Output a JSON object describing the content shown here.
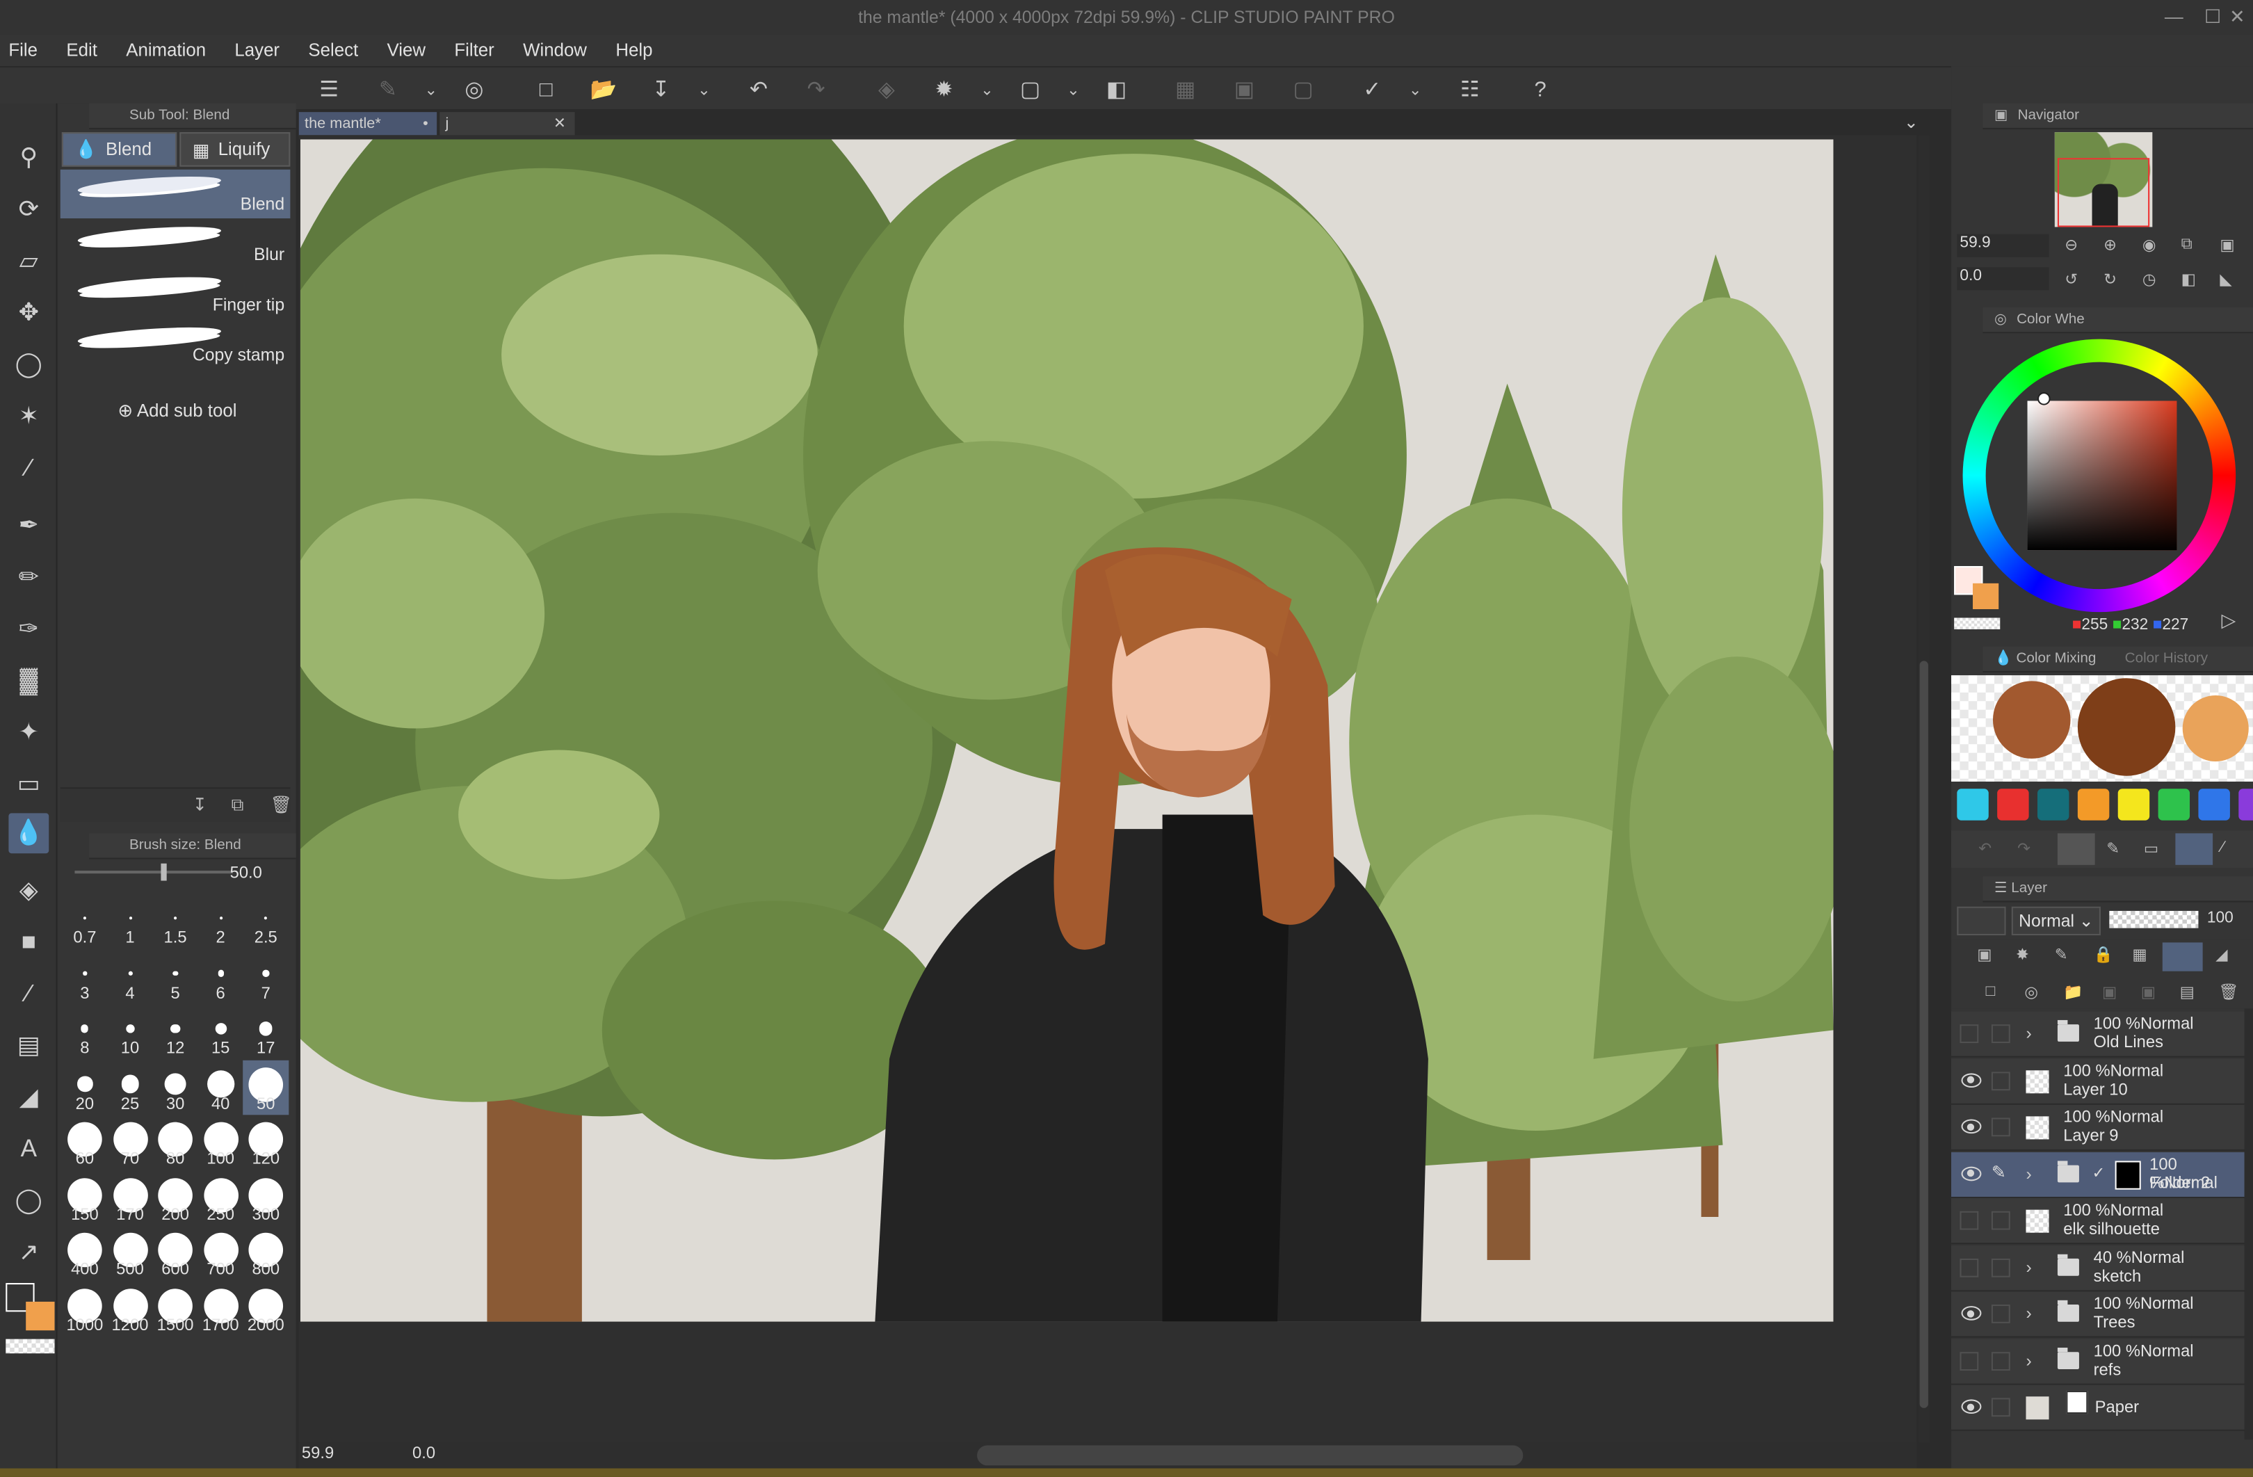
{
  "window": {
    "title": "the mantle* (4000 x 4000px 72dpi 59.9%)  - CLIP STUDIO PAINT PRO"
  },
  "menu": [
    "File",
    "Edit",
    "Animation",
    "Layer",
    "Select",
    "View",
    "Filter",
    "Window",
    "Help"
  ],
  "subtool": {
    "header": "Sub Tool: Blend",
    "tabs": [
      "Blend",
      "Liquify"
    ],
    "brushes": [
      "Blend",
      "Blur",
      "Finger tip",
      "Copy stamp"
    ],
    "add_label": "Add sub tool"
  },
  "brush_size": {
    "header": "Brush size: Blend",
    "value": "50.0",
    "presets": [
      "0.7",
      "1",
      "1.5",
      "2",
      "2.5",
      "3",
      "4",
      "5",
      "6",
      "7",
      "8",
      "10",
      "12",
      "15",
      "17",
      "20",
      "25",
      "30",
      "40",
      "50",
      "60",
      "70",
      "80",
      "100",
      "120",
      "150",
      "170",
      "200",
      "250",
      "300",
      "400",
      "500",
      "600",
      "700",
      "800",
      "1000",
      "1200",
      "1500",
      "1700",
      "2000"
    ],
    "selected": "50"
  },
  "doc_tabs": [
    "the mantle*",
    "j"
  ],
  "status": {
    "zoom": "59.9",
    "angle": "0.0"
  },
  "navigator": {
    "title": "Navigator",
    "zoom": "59.9",
    "rotation": "0.0"
  },
  "color_wheel": {
    "title": "Color Whe",
    "r": "255",
    "g": "232",
    "b": "227",
    "main_color": "#ffe8e3",
    "sub_color": "#f0a04c"
  },
  "color_mixing": {
    "title": "Color Mixing",
    "history_title": "Color History",
    "blobs": [
      "#a2592f",
      "#7e3e18",
      "#e9a35a"
    ],
    "swatches": [
      "#2fc8e8",
      "#e8302f",
      "#156e7a",
      "#f39a28",
      "#f4e61d",
      "#2ec24c",
      "#2f76e9",
      "#8a3bdb"
    ]
  },
  "layer_panel": {
    "title": "Layer",
    "blend_mode": "Normal",
    "opacity": "100"
  },
  "layers": [
    {
      "pct": "100 %",
      "mode": "Normal",
      "name": "Old Lines",
      "type": "folder",
      "visible": false,
      "selected": false
    },
    {
      "pct": "100 %",
      "mode": "Normal",
      "name": "Layer 10",
      "type": "raster",
      "visible": true,
      "selected": false
    },
    {
      "pct": "100 %",
      "mode": "Normal",
      "name": "Layer 9",
      "type": "raster",
      "visible": true,
      "selected": false
    },
    {
      "pct": "100 %",
      "mode": "Normal",
      "name": "Folder 2",
      "type": "folder",
      "visible": true,
      "selected": true
    },
    {
      "pct": "100 %",
      "mode": "Normal",
      "name": "elk silhouette",
      "type": "raster",
      "visible": false,
      "selected": false
    },
    {
      "pct": "40 %",
      "mode": "Normal",
      "name": "sketch",
      "type": "folder",
      "visible": false,
      "selected": false
    },
    {
      "pct": "100 %",
      "mode": "Normal",
      "name": "Trees",
      "type": "folder",
      "visible": true,
      "selected": false
    },
    {
      "pct": "100 %",
      "mode": "Normal",
      "name": "refs",
      "type": "folder",
      "visible": false,
      "selected": false
    },
    {
      "pct": "",
      "mode": "",
      "name": "Paper",
      "type": "paper",
      "visible": true,
      "selected": false
    }
  ],
  "colors": {
    "accent": "#52627e",
    "panel": "#353535",
    "canvas_bg": "#dedbd5"
  }
}
